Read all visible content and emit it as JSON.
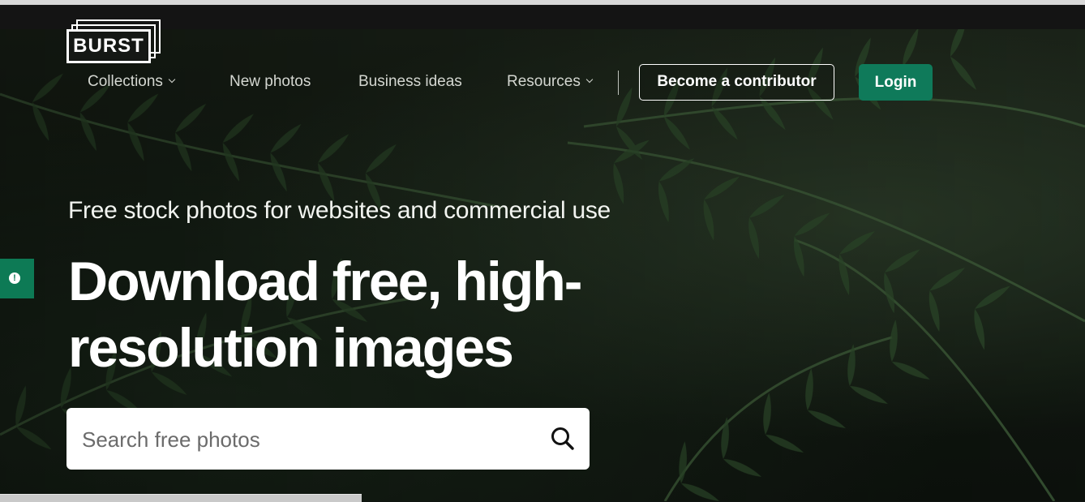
{
  "brand": {
    "logo_text": "BURST"
  },
  "nav": {
    "items": [
      {
        "label": "Collections",
        "has_dropdown": true
      },
      {
        "label": "New photos",
        "has_dropdown": false
      },
      {
        "label": "Business ideas",
        "has_dropdown": false
      },
      {
        "label": "Resources",
        "has_dropdown": true
      }
    ],
    "contributor_button": "Become a contributor",
    "login_button": "Login"
  },
  "hero": {
    "subtitle": "Free stock photos for websites and commercial use",
    "headline": "Download free, high-resolution images",
    "background": "fern-leaves"
  },
  "search": {
    "placeholder": "Search free photos",
    "value": "",
    "icon": "search-icon"
  },
  "feedback": {
    "icon": "alert-icon"
  },
  "colors": {
    "accent": "#0f7a5a",
    "text": "#ffffff",
    "nav_text": "#d4d7d1"
  }
}
